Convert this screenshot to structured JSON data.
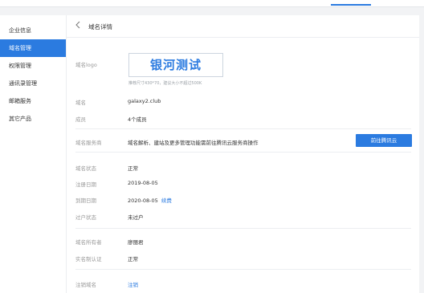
{
  "colors": {
    "accent": "#2b7be0",
    "page_bg": "#f2f3f5",
    "panel_bg": "#ffffff"
  },
  "sidebar": {
    "items": [
      {
        "label": "企业信息",
        "active": false
      },
      {
        "label": "域名管理",
        "active": true
      },
      {
        "label": "权限管理",
        "active": false
      },
      {
        "label": "通讯录管理",
        "active": false
      },
      {
        "label": "邮箱服务",
        "active": false
      },
      {
        "label": "其它产品",
        "active": false
      }
    ]
  },
  "header": {
    "back_icon": "chevron-left-icon",
    "title": "域名详情"
  },
  "detail": {
    "logo_label": "域名logo",
    "logo_text": "银河测试",
    "logo_hint": "推荐尺寸430*70，建议大小不超过500K",
    "domain_label": "域名",
    "domain_value": "galaxy2.club",
    "members_label": "成员",
    "members_value": "4个成员",
    "service_label": "域名服务商",
    "service_value": "域名解析、建站及更多管理功能需前往腾讯云服务商操作",
    "service_button": "前往腾讯云",
    "status_label": "域名状态",
    "status_value": "正常",
    "register_label": "注册日期",
    "register_value": "2019-08-05",
    "expire_label": "到期日期",
    "expire_value": "2020-08-05",
    "renew_link": "续费",
    "expired_label": "过户状态",
    "expired_value": "未过户",
    "owner_label": "域名所有者",
    "owner_value": "廖丽君",
    "realname_label": "实名制认证",
    "realname_value": "正常",
    "cancel_label": "注销域名",
    "cancel_link": "注销"
  }
}
